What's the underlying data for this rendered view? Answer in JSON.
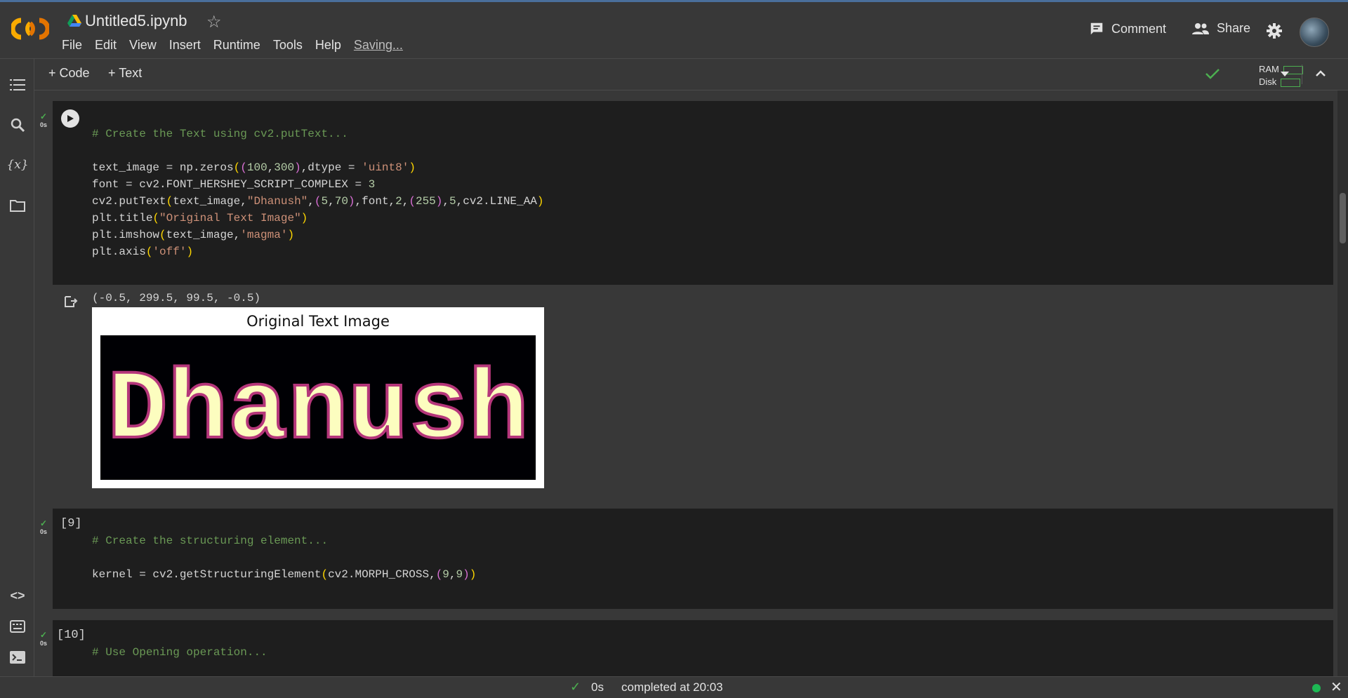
{
  "header": {
    "title": "Untitled5.ipynb",
    "menu": [
      "File",
      "Edit",
      "View",
      "Insert",
      "Runtime",
      "Tools",
      "Help"
    ],
    "saving_label": "Saving...",
    "comment_label": "Comment",
    "share_label": "Share"
  },
  "toolbar": {
    "add_code_label": "Code",
    "add_text_label": "Text",
    "ram_label": "RAM",
    "disk_label": "Disk"
  },
  "cells": [
    {
      "status": "0s",
      "code_lines": [
        "# Create the Text using cv2.putText...",
        "",
        "text_image = np.zeros((100,300),dtype = 'uint8')",
        "font = cv2.FONT_HERSHEY_SCRIPT_COMPLEX = 3",
        "cv2.putText(text_image,\"Dhanush\",(5,70),font,2,(255),5,cv2.LINE_AA)",
        "plt.title(\"Original Text Image\")",
        "plt.imshow(text_image,'magma')",
        "plt.axis('off')"
      ],
      "output_text": "(-0.5, 299.5, 99.5, -0.5)",
      "figure_title": "Original Text Image",
      "figure_text": "Dhanush"
    },
    {
      "exec_count": "[9]",
      "status": "0s",
      "code_lines": [
        "# Create the structuring element...",
        "",
        "kernel = cv2.getStructuringElement(cv2.MORPH_CROSS,(9,9))"
      ]
    },
    {
      "exec_count": "[10]",
      "status": "0s",
      "code_lines": [
        "# Use Opening operation..."
      ]
    }
  ],
  "statusbar": {
    "duration": "0s",
    "completed_text": "completed at 20:03"
  },
  "colors": {
    "background": "#383838",
    "cell_bg": "#1e1e1e",
    "comment": "#6a9955",
    "string": "#ce9178",
    "number": "#b5cea8",
    "success": "#4caf50",
    "accent": "#f9ab00"
  }
}
